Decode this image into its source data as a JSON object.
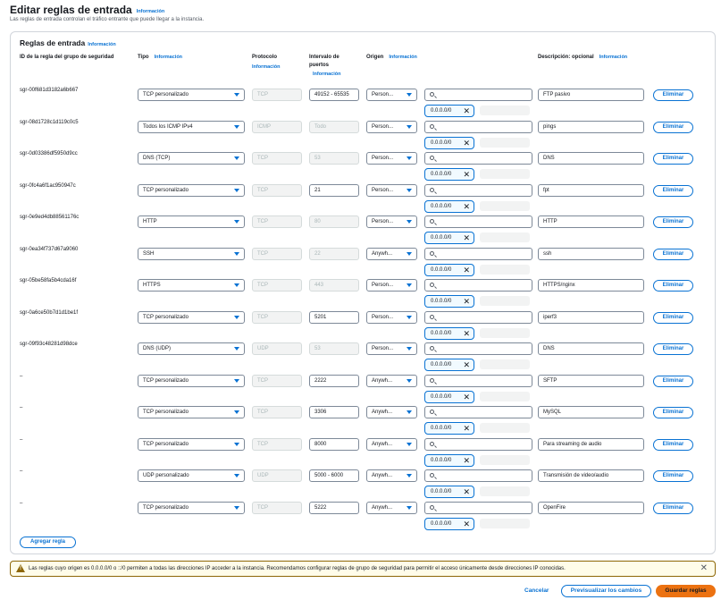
{
  "page": {
    "title": "Editar reglas de entrada",
    "info": "Información",
    "subtitle": "Las reglas de entrada controlan el tráfico entrante que puede llegar a la instancia."
  },
  "panel": {
    "title": "Reglas de entrada",
    "info": "Información",
    "columns": {
      "rule_id": "ID de la regla del grupo de seguridad",
      "type": "Tipo",
      "type_info": "Información",
      "protocol": "Protocolo",
      "protocol_info": "Información",
      "port_range": "Intervalo de puertos",
      "port_info": "Información",
      "origin": "Origen",
      "origin_info": "Información",
      "description": "Descripción: opcional",
      "description_info": "Información"
    },
    "delete_label": "Eliminar",
    "add_rule_label": "Agregar regla",
    "rules": [
      {
        "id": "sgr-00f681d3182a6b667",
        "type": "TCP personalizado",
        "protocol": "TCP",
        "port": "49152 - 65535",
        "port_editable": true,
        "origin": "Person...",
        "cidr": "0.0.0.0/0",
        "description": "FTP pasivo"
      },
      {
        "id": "sgr-08d1728c1d119c0c5",
        "type": "Todos los ICMP IPv4",
        "protocol": "ICMP",
        "port": "Todo",
        "port_editable": false,
        "origin": "Person...",
        "cidr": "0.0.0.0/0",
        "description": "pings"
      },
      {
        "id": "sgr-0d03386df5950d9cc",
        "type": "DNS (TCP)",
        "protocol": "TCP",
        "port": "53",
        "port_editable": false,
        "origin": "Person...",
        "cidr": "0.0.0.0/0",
        "description": "DNS"
      },
      {
        "id": "sgr-0fc4a6f1ac950947c",
        "type": "TCP personalizado",
        "protocol": "TCP",
        "port": "21",
        "port_editable": true,
        "origin": "Person...",
        "cidr": "0.0.0.0/0",
        "description": "fpt"
      },
      {
        "id": "sgr-0e9ed4db88561176c",
        "type": "HTTP",
        "protocol": "TCP",
        "port": "80",
        "port_editable": false,
        "origin": "Person...",
        "cidr": "0.0.0.0/0",
        "description": "HTTP"
      },
      {
        "id": "sgr-0ea34f737d67a9060",
        "type": "SSH",
        "protocol": "TCP",
        "port": "22",
        "port_editable": false,
        "origin": "Anywh...",
        "cidr": "0.0.0.0/0",
        "description": "ssh"
      },
      {
        "id": "sgr-05be58fa5b4cda16f",
        "type": "HTTPS",
        "protocol": "TCP",
        "port": "443",
        "port_editable": false,
        "origin": "Person...",
        "cidr": "0.0.0.0/0",
        "description": "HTTPS/nginx"
      },
      {
        "id": "sgr-0a6ce50b7d1d1be1f",
        "type": "TCP personalizado",
        "protocol": "TCP",
        "port": "5201",
        "port_editable": true,
        "origin": "Person...",
        "cidr": "0.0.0.0/0",
        "description": "iperf3"
      },
      {
        "id": "sgr-09f93c48281d98dce",
        "type": "DNS (UDP)",
        "protocol": "UDP",
        "port": "53",
        "port_editable": false,
        "origin": "Person...",
        "cidr": "0.0.0.0/0",
        "description": "DNS"
      },
      {
        "id": "–",
        "type": "TCP personalizado",
        "protocol": "TCP",
        "port": "2222",
        "port_editable": true,
        "origin": "Anywh...",
        "cidr": "0.0.0.0/0",
        "description": "SFTP"
      },
      {
        "id": "–",
        "type": "TCP personalizado",
        "protocol": "TCP",
        "port": "3306",
        "port_editable": true,
        "origin": "Anywh...",
        "cidr": "0.0.0.0/0",
        "description": "MySQL"
      },
      {
        "id": "–",
        "type": "TCP personalizado",
        "protocol": "TCP",
        "port": "8000",
        "port_editable": true,
        "origin": "Anywh...",
        "cidr": "0.0.0.0/0",
        "description": "Para streaming de audio"
      },
      {
        "id": "–",
        "type": "UDP personalizado",
        "protocol": "UDP",
        "port": "5000 - 6000",
        "port_editable": true,
        "origin": "Anywh...",
        "cidr": "0.0.0.0/0",
        "description": "Transmisión de video/audio"
      },
      {
        "id": "–",
        "type": "TCP personalizado",
        "protocol": "TCP",
        "port": "5222",
        "port_editable": true,
        "origin": "Anywh...",
        "cidr": "0.0.0.0/0",
        "description": "OpenFire"
      }
    ]
  },
  "warning": {
    "text": "Las reglas cuyo origen es 0.0.0.0/0 o ::/0 permiten a todas las direcciones IP acceder a la instancia. Recomendamos configurar reglas de grupo de seguridad para permitir el acceso únicamente desde direcciones IP conocidas."
  },
  "footer": {
    "cancel": "Cancelar",
    "preview": "Previsualizar los cambios",
    "save": "Guardar reglas"
  },
  "colors": {
    "accent": "#0972d3",
    "primary_button": "#ec7211",
    "warning_border": "#8d6605"
  }
}
